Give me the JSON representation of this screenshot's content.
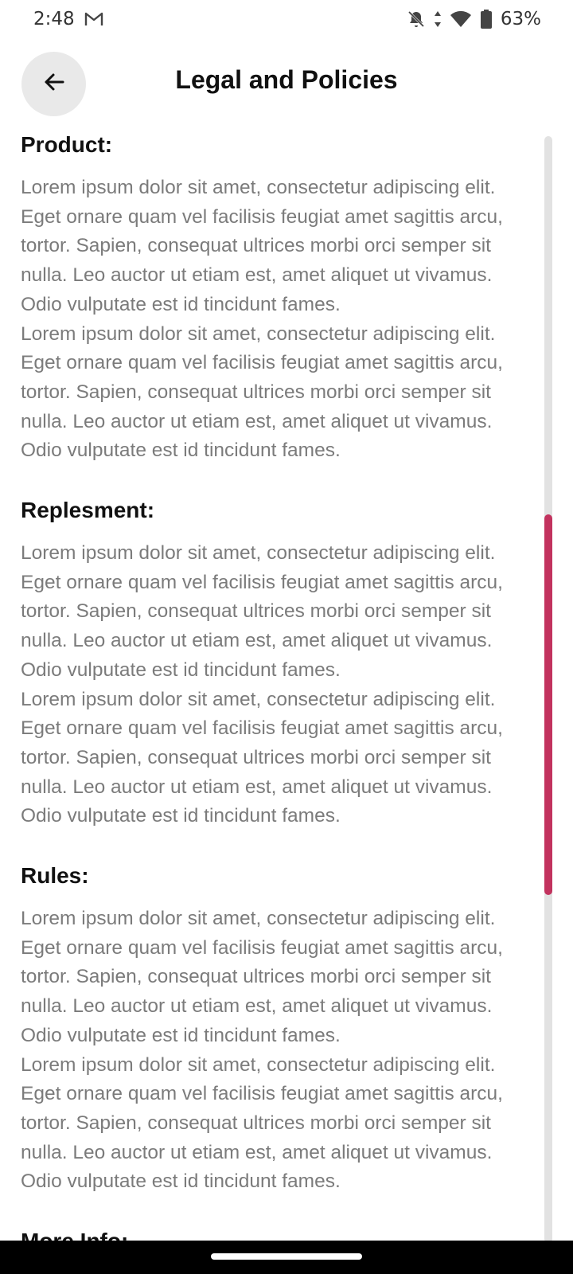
{
  "status_bar": {
    "time": "2:48",
    "battery": "63%",
    "icons": [
      "gmail-icon",
      "bell-off-icon",
      "data-arrows-icon",
      "wifi-icon",
      "battery-icon"
    ]
  },
  "header": {
    "title": "Legal and Policies",
    "back_icon": "arrow-left-icon"
  },
  "sections": [
    {
      "heading": "Product:",
      "paragraphs": [
        "Lorem ipsum dolor sit amet, consectetur adipiscing elit. Eget ornare quam vel facilisis feugiat amet sagittis arcu, tortor. Sapien, consequat ultrices morbi orci semper sit nulla. Leo auctor ut etiam est, amet aliquet ut vivamus. Odio vulputate est id tincidunt fames.",
        "Lorem ipsum dolor sit amet, consectetur adipiscing elit. Eget ornare quam vel facilisis feugiat amet sagittis arcu, tortor. Sapien, consequat ultrices morbi orci semper sit nulla. Leo auctor ut etiam est, amet aliquet ut vivamus. Odio vulputate est id tincidunt fames."
      ]
    },
    {
      "heading": "Replesment:",
      "paragraphs": [
        "Lorem ipsum dolor sit amet, consectetur adipiscing elit. Eget ornare quam vel facilisis feugiat amet sagittis arcu, tortor. Sapien, consequat ultrices morbi orci semper sit nulla. Leo auctor ut etiam est, amet aliquet ut vivamus. Odio vulputate est id tincidunt fames.",
        "Lorem ipsum dolor sit amet, consectetur adipiscing elit. Eget ornare quam vel facilisis feugiat amet sagittis arcu, tortor. Sapien, consequat ultrices morbi orci semper sit nulla. Leo auctor ut etiam est, amet aliquet ut vivamus. Odio vulputate est id tincidunt fames."
      ]
    },
    {
      "heading": "Rules:",
      "paragraphs": [
        "Lorem ipsum dolor sit amet, consectetur adipiscing elit. Eget ornare quam vel facilisis feugiat amet sagittis arcu, tortor. Sapien, consequat ultrices morbi orci semper sit nulla. Leo auctor ut etiam est, amet aliquet ut vivamus. Odio vulputate est id tincidunt fames.",
        "Lorem ipsum dolor sit amet, consectetur adipiscing elit. Eget ornare quam vel facilisis feugiat amet sagittis arcu, tortor. Sapien, consequat ultrices morbi orci semper sit nulla. Leo auctor ut etiam est, amet aliquet ut vivamus. Odio vulputate est id tincidunt fames."
      ]
    },
    {
      "heading": "More Info:",
      "paragraphs": []
    }
  ],
  "colors": {
    "scroll_thumb": "#c2325e",
    "scroll_track": "#e2e2e2",
    "back_button_bg": "#e9e9e9",
    "body_text": "#7b7b7b"
  }
}
